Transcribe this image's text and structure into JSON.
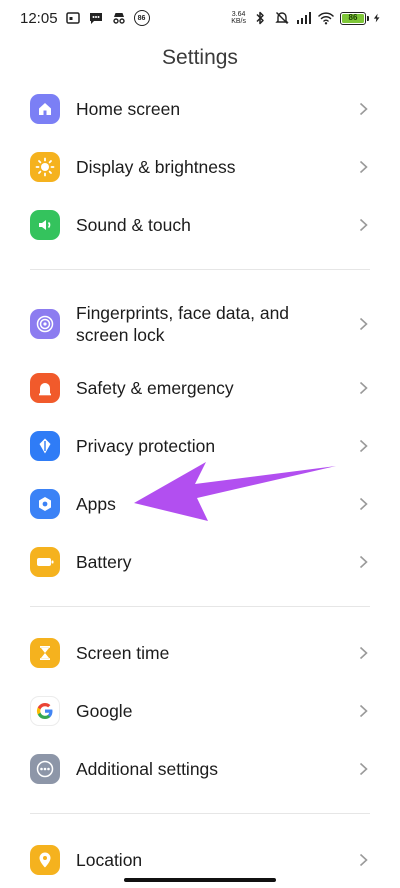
{
  "status_bar": {
    "time": "12:05",
    "net_speed_value": "3.64",
    "net_speed_unit": "KB/s",
    "notif_badge": "86",
    "battery_level": "86"
  },
  "header": {
    "title": "Settings"
  },
  "items": [
    {
      "label": "Home screen",
      "icon": "home-icon",
      "color": "#7b7ff5"
    },
    {
      "label": "Display & brightness",
      "icon": "sun-icon",
      "color": "#f5b21e"
    },
    {
      "label": "Sound & touch",
      "icon": "speaker-icon",
      "color": "#34c35d"
    },
    {
      "label": "Fingerprints, face data, and screen lock",
      "icon": "fingerprint-icon",
      "color": "#8c7cf0"
    },
    {
      "label": "Safety & emergency",
      "icon": "emergency-icon",
      "color": "#f15a2b"
    },
    {
      "label": "Privacy protection",
      "icon": "shield-icon",
      "color": "#2f7cf6"
    },
    {
      "label": "Apps",
      "icon": "apps-gear-icon",
      "color": "#3b82f6"
    },
    {
      "label": "Battery",
      "icon": "battery-icon",
      "color": "#f5b21e"
    },
    {
      "label": "Screen time",
      "icon": "hourglass-icon",
      "color": "#f5b21e"
    },
    {
      "label": "Google",
      "icon": "google-icon",
      "color": "#ffffff"
    },
    {
      "label": "Additional settings",
      "icon": "more-icon",
      "color": "#8d96a8"
    },
    {
      "label": "Location",
      "icon": "location-pin-icon",
      "color": "#f5b21e"
    }
  ],
  "annotation": {
    "color": "#b24ff0"
  }
}
